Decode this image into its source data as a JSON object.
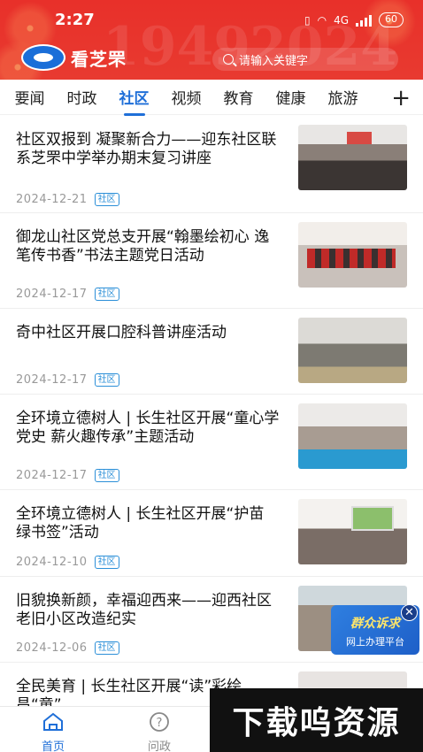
{
  "status_bar": {
    "time": "2:27",
    "network": "4G",
    "battery": "60"
  },
  "header": {
    "logo_text": "看芝罘",
    "bg_year_left": "1949",
    "bg_year_right": "2024",
    "search_placeholder": "请输入关键字"
  },
  "tabs": [
    {
      "label": "要闻"
    },
    {
      "label": "时政"
    },
    {
      "label": "社区"
    },
    {
      "label": "视频"
    },
    {
      "label": "教育"
    },
    {
      "label": "健康"
    },
    {
      "label": "旅游"
    }
  ],
  "add_tab_label": "+",
  "news": [
    {
      "title": "社区双报到  凝聚新合力——迎东社区联系芝罘中学举办期末复习讲座",
      "date": "2024-12-21",
      "tag": "社区"
    },
    {
      "title": "御龙山社区党总支开展“翰墨绘初心  逸笔传书香”书法主题党日活动",
      "date": "2024-12-17",
      "tag": "社区"
    },
    {
      "title": "奇中社区开展口腔科普讲座活动",
      "date": "2024-12-17",
      "tag": "社区"
    },
    {
      "title": "全环境立德树人 | 长生社区开展“童心学党史  薪火趣传承”主题活动",
      "date": "2024-12-17",
      "tag": "社区"
    },
    {
      "title": "全环境立德树人 | 长生社区开展“护苗  绿书签”活动",
      "date": "2024-12-10",
      "tag": "社区"
    },
    {
      "title": "旧貌换新颜，幸福迎西来——迎西社区老旧小区改造纪实",
      "date": "2024-12-06",
      "tag": "社区"
    },
    {
      "title": "全民美育 | 长生社区开展“读”彩绘昌“童”",
      "date": "",
      "tag": ""
    }
  ],
  "float_badge": {
    "line1": "群众诉求",
    "line2": "网上办理平台",
    "close": "✕"
  },
  "bottom_nav": [
    {
      "label": "首页",
      "icon": "home-icon"
    },
    {
      "label": "问政",
      "icon": "question-icon"
    }
  ],
  "watermark": "下载呜资源"
}
